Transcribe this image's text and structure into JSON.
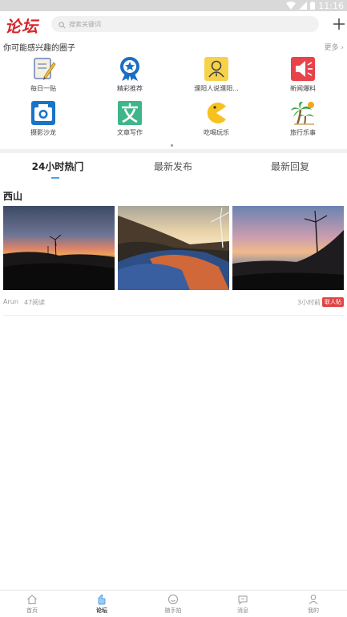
{
  "status_bar": {
    "time": "11:16"
  },
  "header": {
    "logo": "论坛",
    "search_placeholder": "搜索关键词"
  },
  "interest": {
    "title": "你可能感兴趣的圈子",
    "more": "更多",
    "items": [
      {
        "label": "每日一贴",
        "icon": "daily-post-icon"
      },
      {
        "label": "精彩推荐",
        "icon": "recommend-badge-icon"
      },
      {
        "label": "濮阳人说濮阳...",
        "icon": "person-card-icon"
      },
      {
        "label": "新闻爆料",
        "icon": "megaphone-icon"
      },
      {
        "label": "摄影沙龙",
        "icon": "camera-icon"
      },
      {
        "label": "文章写作",
        "icon": "writing-icon"
      },
      {
        "label": "吃喝玩乐",
        "icon": "pacman-icon"
      },
      {
        "label": "旅行乐事",
        "icon": "palm-tree-icon"
      }
    ]
  },
  "tabs": [
    "24小时热门",
    "最新发布",
    "最新回复"
  ],
  "post": {
    "title": "西山",
    "author": "Arun",
    "reads": "47阅读",
    "time": "3小时前",
    "badge": "联人贴"
  },
  "bottom_nav": [
    "首页",
    "论坛",
    "随手拍",
    "消息",
    "我的"
  ],
  "colors": {
    "brand_red": "#d6262b",
    "tab_indicator": "#4aa3e8",
    "badge_red": "#e04444"
  }
}
